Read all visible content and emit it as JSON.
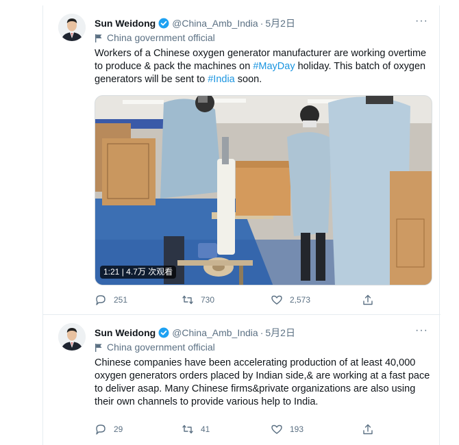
{
  "tweets": [
    {
      "name": "Sun Weidong",
      "handle": "@China_Amb_India",
      "dot": "·",
      "time": "5月2日",
      "label": "China government official",
      "text_segments": [
        {
          "text": "Workers of a Chinese oxygen generator manufacturer are working overtime to produce & pack the machines on ",
          "hashtag": false
        },
        {
          "text": "#MayDay",
          "hashtag": true
        },
        {
          "text": " holiday. This batch of oxygen generators will be sent to ",
          "hashtag": false
        },
        {
          "text": "#India",
          "hashtag": true
        },
        {
          "text": " soon.",
          "hashtag": false
        }
      ],
      "video_badge": "1:21 | 4.7万 次观看",
      "replies": "251",
      "retweets": "730",
      "likes": "2,573"
    },
    {
      "name": "Sun Weidong",
      "handle": "@China_Amb_India",
      "dot": "·",
      "time": "5月2日",
      "label": "China government official",
      "text": "Chinese companies have been accelerating production of at least 40,000 oxygen generators orders placed by Indian side,& are working at a fast pace to deliver asap. Many Chinese firms&private organizations are also using their own channels to provide various help to India.",
      "replies": "29",
      "retweets": "41",
      "likes": "193"
    }
  ],
  "icons": {
    "verified": "verified-badge-icon",
    "label": "flag-icon",
    "more": "more-icon",
    "reply": "reply-icon",
    "retweet": "retweet-icon",
    "like": "like-icon",
    "share": "share-icon"
  },
  "colors": {
    "accent": "#1b95e0",
    "secondary_text": "#5b7083",
    "verified": "#1da1f2"
  }
}
